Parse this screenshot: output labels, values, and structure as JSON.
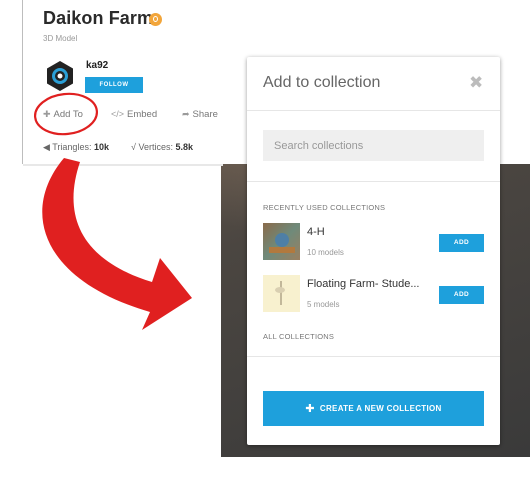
{
  "model": {
    "title": "Daikon Farm",
    "subtitle": "3D Model",
    "username": "ka92",
    "follow_label": "FOLLOW"
  },
  "actions": {
    "add_to": "Add To",
    "embed": "Embed",
    "share": "Share"
  },
  "stats": {
    "triangles_label": "Triangles:",
    "triangles_value": "10k",
    "vertices_label": "Vertices:",
    "vertices_value": "5.8k"
  },
  "modal": {
    "title": "Add to collection",
    "close_icon": "✖",
    "search_placeholder": "Search collections",
    "recent_label": "RECENTLY USED COLLECTIONS",
    "all_label": "ALL COLLECTIONS",
    "collections": [
      {
        "name": "4-H",
        "count": "10 models",
        "add_label": "ADD"
      },
      {
        "name": "Floating Farm- Stude...",
        "count": "5 models",
        "add_label": "ADD"
      }
    ],
    "create_label": "CREATE A NEW COLLECTION"
  },
  "colors": {
    "accent": "#1ea0dc",
    "annotation": "#e02020"
  },
  "icons": {
    "badge": "orange-badge-icon",
    "add": "plus-icon",
    "embed": "code-icon",
    "share": "share-arrow-icon",
    "triangles": "triangle-icon",
    "vertices": "vertex-icon"
  }
}
